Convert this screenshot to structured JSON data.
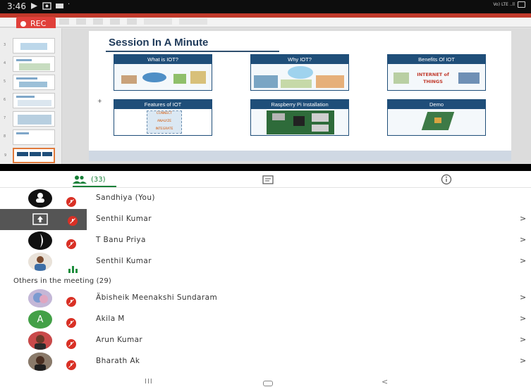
{
  "status_bar": {
    "time": "3:46",
    "right_text": "Vo) LTE ..ll"
  },
  "recording": {
    "label": "REC",
    "color": "#e0403a"
  },
  "presentation": {
    "slide_title": "Session In A Minute",
    "cards": [
      {
        "title": "What is IOT?"
      },
      {
        "title": "Why IOT?"
      },
      {
        "title": "Benefits Of IOT"
      },
      {
        "title": "Features of IOT"
      },
      {
        "title": "Raspberry Pi Installation"
      },
      {
        "title": "Demo"
      }
    ],
    "feature_tags": [
      "CONNECT",
      "ANALYZE",
      "INTEGRATE"
    ],
    "iot_logo_text": "INTERNET of THINGS",
    "accent_color": "#1f4e79"
  },
  "tabs": {
    "people_count": "(33)",
    "people_icon": "people-icon",
    "chat_icon": "chat-icon",
    "info_icon": "info-icon",
    "active_color": "#188038"
  },
  "participants": [
    {
      "name": "Sandhiya (You)",
      "mic": "muted"
    },
    {
      "name": "Senthil Kumar",
      "mic": "muted",
      "presenting": true
    },
    {
      "name": "T Banu Priya",
      "mic": "muted"
    },
    {
      "name": "Senthil Kumar",
      "mic": "speaking"
    }
  ],
  "others_header": "Others in the meeting (29)",
  "others": [
    {
      "name": "Äbisheik Meenakshi Sundaram",
      "mic": "muted"
    },
    {
      "name": "Akila M",
      "mic": "muted",
      "initial": "A"
    },
    {
      "name": "Arun Kumar",
      "mic": "muted"
    },
    {
      "name": "Bharath Ak",
      "mic": "muted"
    }
  ],
  "chevron": ">",
  "navbar": {
    "recents": "III",
    "back": "<"
  }
}
